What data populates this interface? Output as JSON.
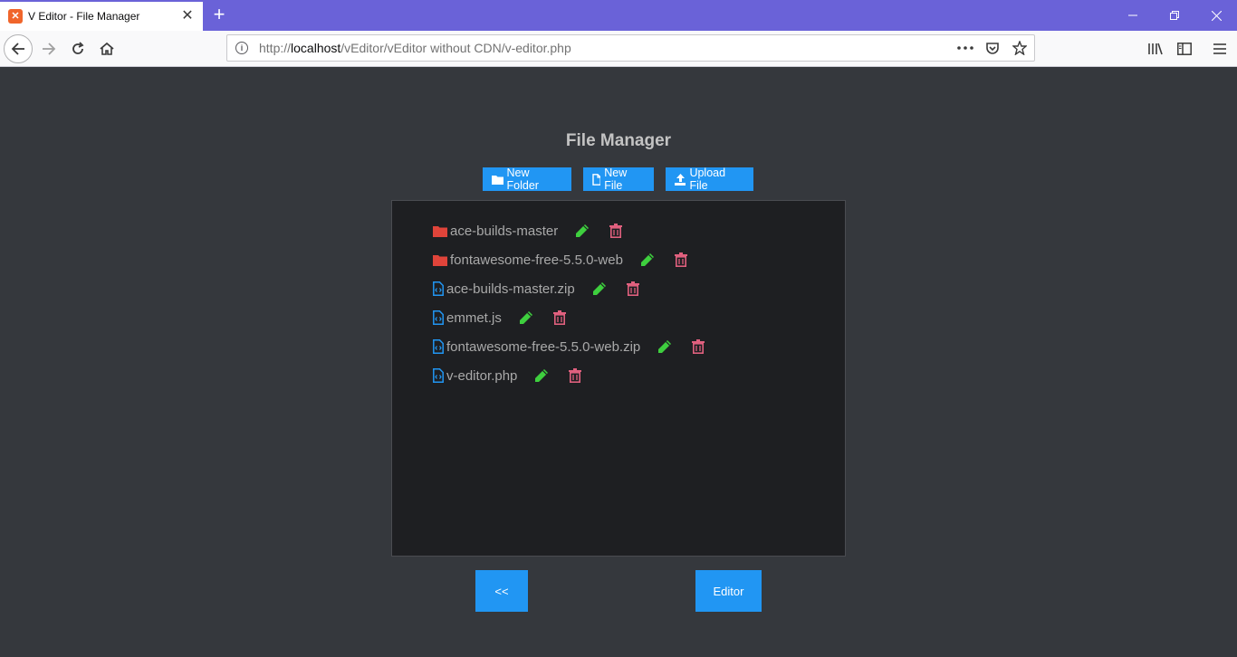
{
  "browser": {
    "tab_title": "V Editor - File Manager",
    "url_prefix": "http://",
    "url_host": "localhost",
    "url_path": "/vEditor/vEditor without CDN/v-editor.php"
  },
  "page": {
    "title": "File Manager",
    "buttons": {
      "new_folder": "New Folder",
      "new_file": "New File",
      "upload_file": "Upload File",
      "back": "<<",
      "editor": "Editor"
    }
  },
  "files": [
    {
      "name": "ace-builds-master",
      "type": "folder"
    },
    {
      "name": "fontawesome-free-5.5.0-web",
      "type": "folder"
    },
    {
      "name": "ace-builds-master.zip",
      "type": "file"
    },
    {
      "name": "emmet.js",
      "type": "file"
    },
    {
      "name": "fontawesome-free-5.5.0-web.zip",
      "type": "file"
    },
    {
      "name": "v-editor.php",
      "type": "file"
    }
  ],
  "colors": {
    "accent": "#2196f3",
    "folder": "#e0443a",
    "file": "#2196f3",
    "edit": "#3ecf3e",
    "delete": "#e0607e",
    "titlebar": "#6a62d8"
  }
}
